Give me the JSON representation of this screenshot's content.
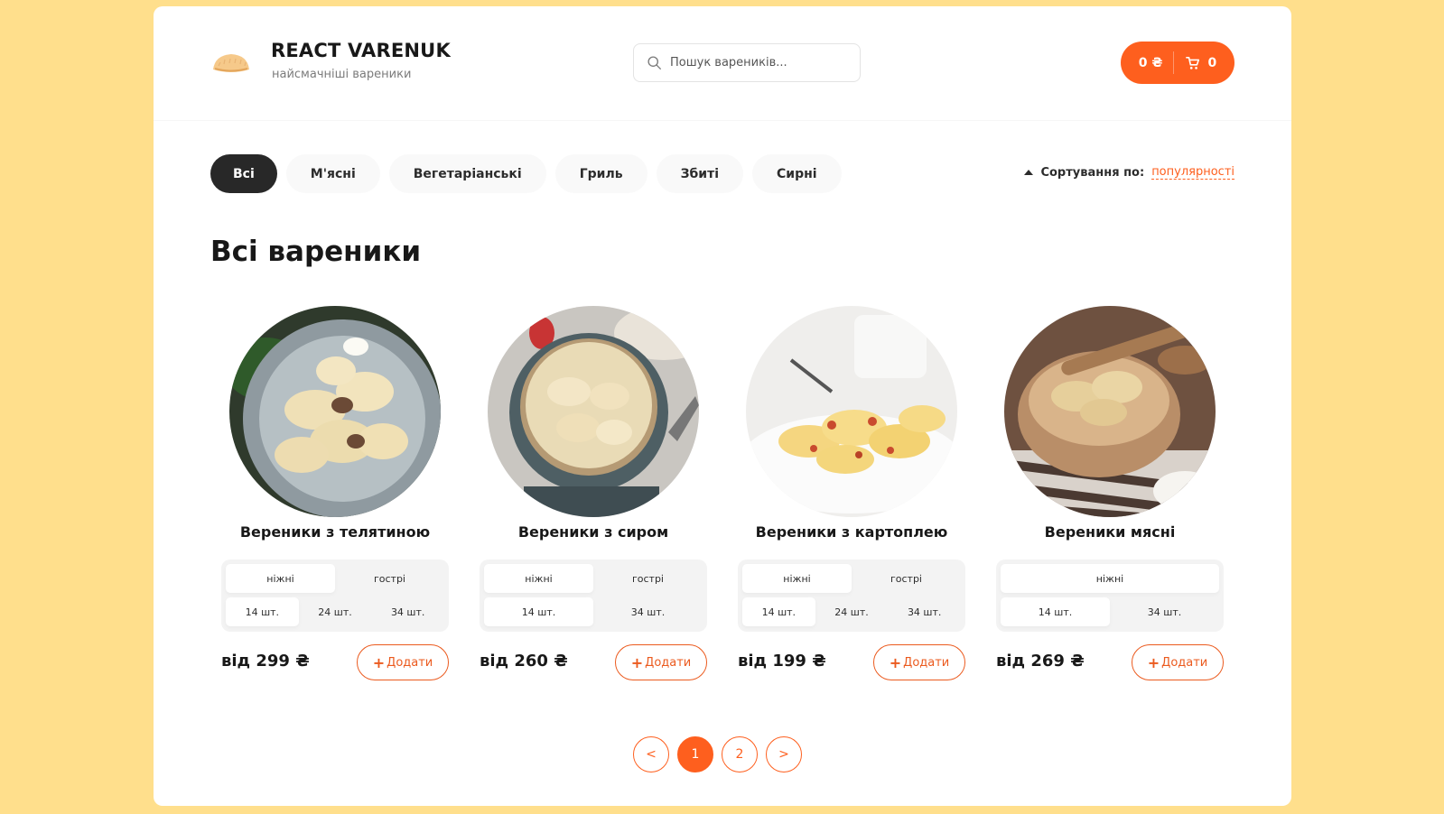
{
  "header": {
    "title": "REACT VARENUK",
    "subtitle": "найсмачніші вареники",
    "search_placeholder": "Пошук вареників...",
    "cart_total": "0 ₴",
    "cart_count": "0"
  },
  "categories": [
    "Всі",
    "М'ясні",
    "Вегетаріанські",
    "Гриль",
    "Збиті",
    "Сирні"
  ],
  "active_category": "Всі",
  "sort": {
    "label": "Сортування по:",
    "value": "популярності"
  },
  "page_title": "Всі вареники",
  "products": [
    {
      "name": "Вереники з телятиною",
      "types": [
        "ніжні",
        "гострі"
      ],
      "sizes": [
        "14 шт.",
        "24 шт.",
        "34 шт."
      ],
      "price": "від 299 ₴",
      "add_label": "Додати"
    },
    {
      "name": "Вереники з сиром",
      "types": [
        "ніжні",
        "гострі"
      ],
      "sizes": [
        "14 шт.",
        "34 шт."
      ],
      "price": "від 260 ₴",
      "add_label": "Додати"
    },
    {
      "name": "Вереники з картоплею",
      "types": [
        "ніжні",
        "гострі"
      ],
      "sizes": [
        "14 шт.",
        "24 шт.",
        "34 шт."
      ],
      "price": "від 199 ₴",
      "add_label": "Додати"
    },
    {
      "name": "Вереники мясні",
      "types": [
        "ніжні"
      ],
      "sizes": [
        "14 шт.",
        "34 шт."
      ],
      "price": "від 269 ₴",
      "add_label": "Додати"
    }
  ],
  "pagination": {
    "prev": "<",
    "pages": [
      "1",
      "2"
    ],
    "next": ">",
    "active": "1"
  },
  "colors": {
    "accent": "#FE5F1E",
    "background": "#FFDF8C",
    "dark": "#282828"
  }
}
